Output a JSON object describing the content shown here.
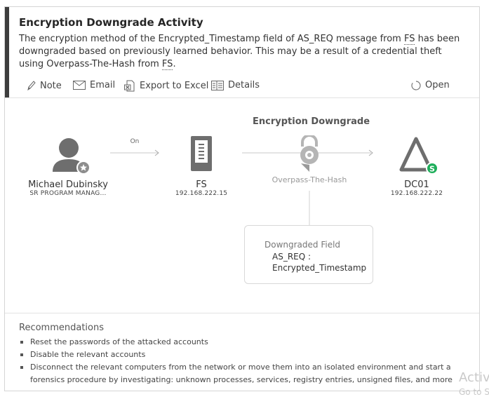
{
  "alert": {
    "title": "Encryption Downgrade Activity",
    "desc_part1": "The encryption method of the Encrypted_Timestamp field of AS_REQ message from ",
    "desc_fs1": "FS",
    "desc_part2": " has been downgraded based on previously learned behavior. This may be a result of a credential theft using Overpass-The-Hash from ",
    "desc_fs2": "FS",
    "desc_part3": "."
  },
  "actions": {
    "note": "Note",
    "email": "Email",
    "export": "Export to Excel",
    "details": "Details",
    "status": "Open"
  },
  "graph": {
    "section_title": "Encryption Downgrade",
    "edge_label": "On",
    "user": {
      "name": "Michael Dubinsky",
      "role": "SR PROGRAM MANAG..."
    },
    "source": {
      "name": "FS",
      "ip": "192.168.222.15"
    },
    "attack": {
      "name": "Overpass-The-Hash"
    },
    "target": {
      "name": "DC01",
      "ip": "192.168.222.22"
    },
    "card": {
      "title": "Downgraded Field",
      "value_line1": "AS_REQ :",
      "value_line2": "Encrypted_Timestamp"
    }
  },
  "recommendations": {
    "title": "Recommendations",
    "items": [
      "Reset the passwords of the attacked accounts",
      "Disable the relevant accounts",
      "Disconnect the relevant computers from the network or move them into an isolated environment and start a forensics procedure by investigating: unknown processes, services, registry entries, unsigned files, and more"
    ]
  },
  "watermark": {
    "line1": "Activ",
    "line2": "Go to S"
  },
  "colors": {
    "accent_bar": "#3d3d3d",
    "sensitive_badge": "#1fae5b",
    "icon_gray": "#6e6e6e"
  }
}
